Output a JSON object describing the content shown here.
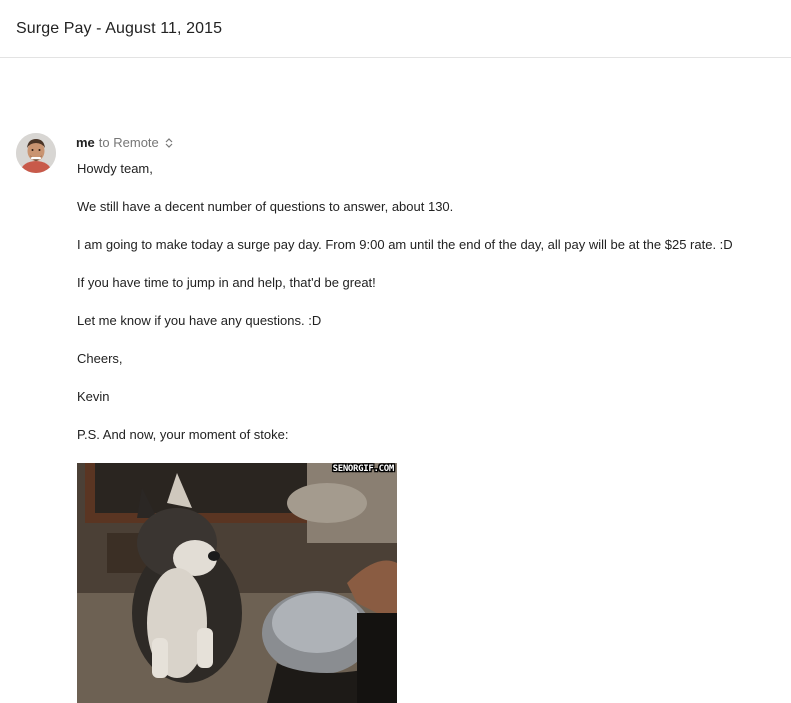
{
  "email": {
    "subject": "Surge Pay - August 11, 2015",
    "sender": "me",
    "recipient_text": "to Remote",
    "paragraphs": [
      "Howdy team,",
      "We still have a decent number of questions to answer, about 130.",
      "I am going to make today a surge pay day. From 9:00 am until the end of the day, all pay will be at the $25 rate. :D",
      "If you have time to jump in and help, that'd be great!",
      "Let me know if you have any questions. :D",
      "Cheers,",
      "Kevin",
      "P.S. And now, your moment of stoke:"
    ],
    "image_caption": "SENORGIF.COM"
  },
  "icons": {
    "avatar": "avatar",
    "recipients_toggle": "chevron-updown-icon"
  }
}
